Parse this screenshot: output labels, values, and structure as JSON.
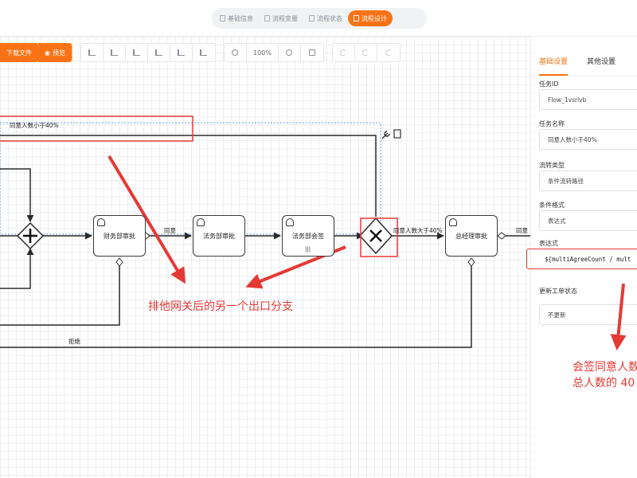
{
  "top_tabs": {
    "items": [
      {
        "label": "基础信息"
      },
      {
        "label": "流程变量"
      },
      {
        "label": "流程状态"
      },
      {
        "label": "流程设计",
        "active": true
      }
    ]
  },
  "toolbar": {
    "download_label": "下载文件",
    "preview_label": "预览",
    "zoom_level": "100%"
  },
  "diagram": {
    "nodes": {
      "finance_approval": "财务部审批",
      "legal_approval": "法务部审批",
      "legal_countersign": "法务部会签",
      "gm_approval": "总经理审批"
    },
    "edges": {
      "agree_under_40": "同意人数小于40%",
      "agree": "同意",
      "agree_over_40": "同意人数大于40%",
      "reject": "拒绝",
      "agree_right": "同意"
    },
    "annotations": {
      "gateway_note": "排他网关后的另一个出口分支",
      "panel_note_line1": "会签同意人数",
      "panel_note_line2": "总人数的 40"
    }
  },
  "panel": {
    "tabs": [
      {
        "label": "基础设置",
        "active": true
      },
      {
        "label": "其他设置"
      }
    ],
    "fields": [
      {
        "label": "任务ID",
        "value": "Flow_1vsrivb"
      },
      {
        "label": "任务名称",
        "value": "同意人数小于40%"
      },
      {
        "label": "流转类型",
        "value": "条件流转路径"
      },
      {
        "label": "条件格式",
        "value": "表达式"
      },
      {
        "label": "表达式",
        "value": "${multiAgreeCount / mult"
      },
      {
        "label": "更新工单状态",
        "value": "不更新"
      }
    ]
  },
  "colors": {
    "accent": "#f97316",
    "annotation": "#e53935"
  }
}
